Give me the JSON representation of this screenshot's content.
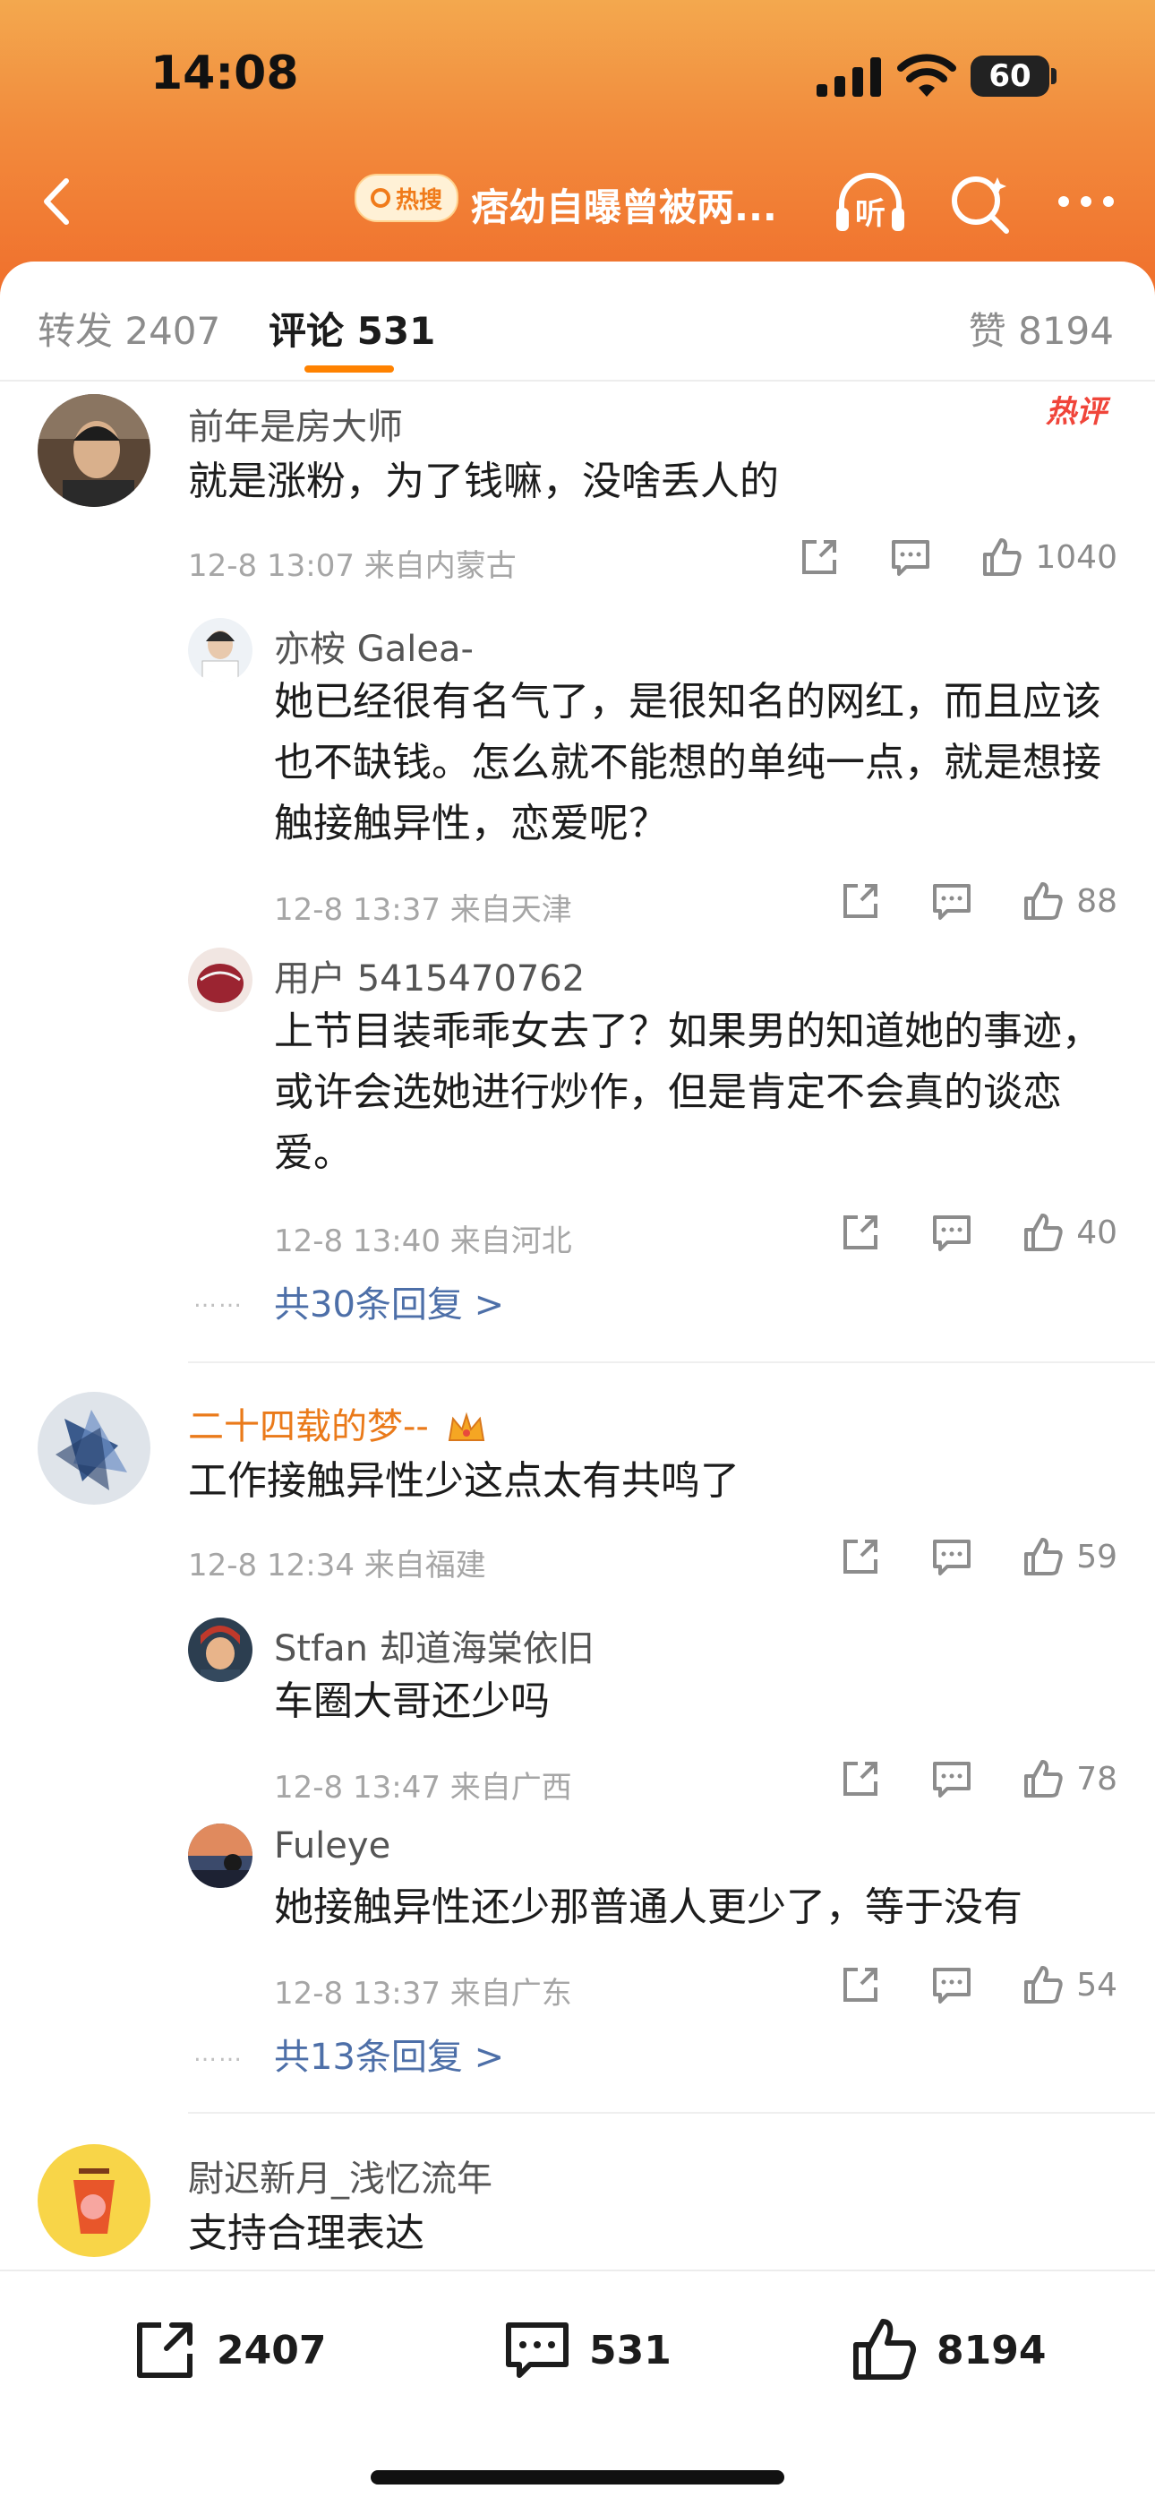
{
  "status_bar": {
    "time": "14:08",
    "battery": "60"
  },
  "nav": {
    "hot_badge": "热搜",
    "title": "痞幼自曝曾被两...",
    "listen_label": "听"
  },
  "tabs": {
    "repost": "转发 2407",
    "comment": "评论 531",
    "like": "赞 8194"
  },
  "comments": [
    {
      "user": "前年是房大师",
      "text": "就是涨粉，为了钱嘛，没啥丢人的",
      "meta": "12-8 13:07 来自内蒙古",
      "likes": "1040",
      "tag": "热评",
      "replies": [
        {
          "user": "亦桉 Galea-",
          "text": "她已经很有名气了，是很知名的网红，而且应该也不缺钱。怎么就不能想的单纯一点，就是想接触接触异性，恋爱呢？",
          "meta": "12-8 13:37 来自天津",
          "likes": "88"
        },
        {
          "user": "用户 5415470762",
          "text": "上节目装乖乖女去了？如果男的知道她的事迹，或许会选她进行炒作，但是肯定不会真的谈恋爱。",
          "meta": "12-8 13:40 来自河北",
          "likes": "40"
        }
      ],
      "more_replies": "共30条回复 >",
      "dots": "……"
    },
    {
      "user": "二十四载的梦--",
      "text": "工作接触异性少这点太有共鸣了",
      "meta": "12-8 12:34 来自福建",
      "likes": "59",
      "replies": [
        {
          "user": "Stfan 却道海棠依旧",
          "text": "车圈大哥还少吗",
          "meta": "12-8 13:47 来自广西",
          "likes": "78"
        },
        {
          "user": "Fuleye",
          "text": "她接触异性还少那普通人更少了，等于没有",
          "meta": "12-8 13:37 来自广东",
          "likes": "54"
        }
      ],
      "more_replies": "共13条回复 >",
      "dots": "……"
    },
    {
      "user": "尉迟新月_浅忆流年",
      "text": "支持合理表达"
    }
  ],
  "bottom_bar": {
    "repost": "2407",
    "comment": "531",
    "like": "8194"
  },
  "colors": {
    "accent": "#ff8200",
    "header_top": "#f3a84e",
    "header_bottom": "#f06f2c",
    "link": "#4d6fa8",
    "vip_name": "#ea7a1a",
    "hot_tag": "#f0453a"
  }
}
